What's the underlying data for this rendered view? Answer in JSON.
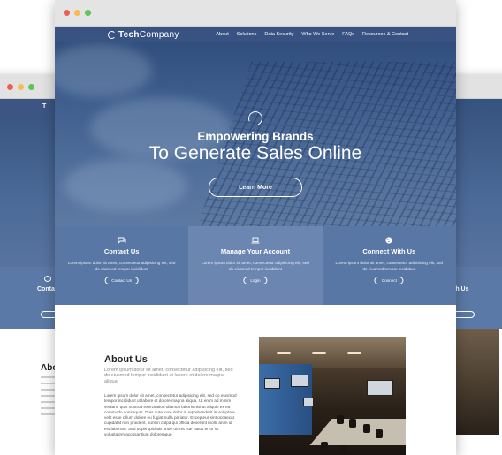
{
  "browser": {
    "dot_colors": [
      "#ee5c54",
      "#f5be4f",
      "#60c557"
    ]
  },
  "nav": {
    "brand_prefix": "Tech",
    "brand_suffix": "Company",
    "items": [
      "About",
      "Solutions",
      "Data Security",
      "Who We Serve",
      "FAQs",
      "Resources & Contact"
    ]
  },
  "hero": {
    "emblem_icon": "globe-swirl-icon",
    "headline": "Empowering Brands",
    "subheadline": "To Generate Sales Online",
    "cta_label": "Learn More"
  },
  "features": [
    {
      "icon": "chat-icon",
      "title": "Contact Us",
      "desc": "Lorem ipsum dolor sit amet, consectetur adipisicing elit, sed do eiusmod tempor incididunt",
      "button": "Contact Us",
      "color": "#5877a5"
    },
    {
      "icon": "laptop-icon",
      "title": "Manage Your Account",
      "desc": "Lorem ipsum dolor sit amet, consectetur adipisicing elit, sed do eiusmod tempor incididunt",
      "button": "Login",
      "color": "#6b87b1"
    },
    {
      "icon": "globe-icon",
      "title": "Connect With Us",
      "desc": "Lorem ipsum dolor sit amet, consectetur adipisicing elit, sed do eiusmod tempor incididunt",
      "button": "Connect",
      "color": "#5877a5"
    }
  ],
  "about": {
    "title": "About Us",
    "subtitle": "Lorem ipsum dolor sit amet, consectetur adipisicing elit, sed do eiusmod tempor incididunt ut labore et dolore magna aliqua.",
    "body": "Lorem ipsum dolor sit amet, consectetur adipisicing elit, sed do eiusmod tempor incididunt ut labore et dolore magna aliqua. Ut enim ad minim veniam, quis nostrud exercitation ullamco laboris nisi ut aliquip ex ea commodo consequat. Duis aute irure dolor in reprehenderit in voluptate velit esse cillum dolore eu fugiat nulla pariatur. Excepteur sint occaecat cupidatat non proident, sunt in culpa qui officia deserunt mollit anim id est laborum. Sed ut perspiciatis unde omnis iste natus error sit voluptatem accusantium doloremque"
  },
  "back_left": {
    "brand": "T",
    "feature_title": "Conta",
    "about_title": "Abou"
  },
  "back_right": {
    "feature_title": "th Us"
  }
}
